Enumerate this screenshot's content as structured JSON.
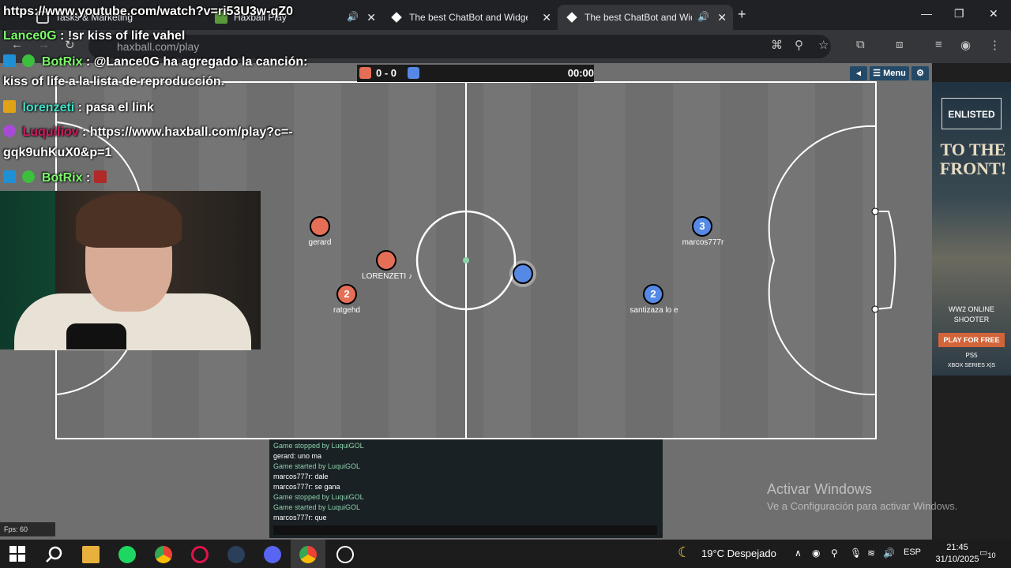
{
  "browser": {
    "tabs": [
      {
        "title": "Tasks & Marketing"
      },
      {
        "title": "Haxball Play"
      },
      {
        "title": "The best ChatBot and Widgets"
      },
      {
        "title": "The best ChatBot and Widg"
      }
    ],
    "url": "haxball.com/play",
    "new_tab": "+",
    "close": "✕"
  },
  "game": {
    "score": "0 - 0",
    "time": "00:00",
    "menu_label": "☰ Menu",
    "players": [
      {
        "name": "gerard",
        "number": "",
        "team": "red"
      },
      {
        "name": "LORENZETI ♪",
        "number": "",
        "team": "red"
      },
      {
        "name": "ratgehd",
        "number": "2",
        "team": "red"
      },
      {
        "name": "marcos777r",
        "number": "3",
        "team": "blue"
      },
      {
        "name": "santizaza lo e",
        "number": "2",
        "team": "blue"
      },
      {
        "name": "",
        "number": "",
        "team": "blue"
      }
    ],
    "chat": [
      {
        "text": "Game stopped by LuquiGOL",
        "sys": true
      },
      {
        "text": "gerard: uno ma",
        "sys": false
      },
      {
        "text": "Game started by LuquiGOL",
        "sys": true
      },
      {
        "text": "marcos777r: dale",
        "sys": false
      },
      {
        "text": "marcos777r: se gana",
        "sys": false
      },
      {
        "text": "Game stopped by LuquiGOL",
        "sys": true
      },
      {
        "text": "Game started by LuquiGOL",
        "sys": true
      },
      {
        "text": "marcos777r: que",
        "sys": false
      }
    ],
    "fps": "Fps: 60"
  },
  "ad": {
    "logo": "ENLISTED",
    "headline": "TO THE FRONT!",
    "sub": "WW2 ONLINE SHOOTER",
    "button": "PLAY FOR FREE",
    "ps": "PS5",
    "xbox": "XBOX SERIES X|S"
  },
  "watermark": {
    "title": "Activar Windows",
    "subtitle": "Ve a Configuración para activar Windows."
  },
  "overlay": {
    "url_line": "https://www.youtube.com/watch?v=ri53U3w-qZ0",
    "lines": [
      {
        "user": "Lance0G",
        "text": ": !sr kiss of life vahel"
      },
      {
        "user": "BotRix",
        "text": ": @Lance0G ha agregado la canción:"
      },
      {
        "user": "",
        "text": "kiss of life a la lista de reproducción."
      },
      {
        "user": "lorenzeti",
        "text": ": pasa el link"
      },
      {
        "user": "Luquiliov",
        "text": ": https://www.haxball.com/play?c=-"
      },
      {
        "user": "",
        "text": "gqk9uhKuX0&p=1"
      },
      {
        "user": "BotRix",
        "text": ":"
      }
    ]
  },
  "taskbar": {
    "weather": "19°C  Despejado",
    "lang": "ESP",
    "time": "21:45",
    "date": "31/10/2025",
    "notif": "10"
  }
}
